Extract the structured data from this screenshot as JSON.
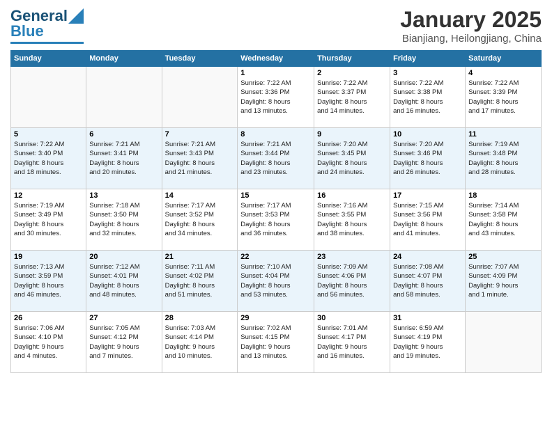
{
  "header": {
    "logo_general": "General",
    "logo_blue": "Blue",
    "month": "January 2025",
    "location": "Bianjiang, Heilongjiang, China"
  },
  "weekdays": [
    "Sunday",
    "Monday",
    "Tuesday",
    "Wednesday",
    "Thursday",
    "Friday",
    "Saturday"
  ],
  "weeks": [
    [
      {
        "day": "",
        "info": ""
      },
      {
        "day": "",
        "info": ""
      },
      {
        "day": "",
        "info": ""
      },
      {
        "day": "1",
        "info": "Sunrise: 7:22 AM\nSunset: 3:36 PM\nDaylight: 8 hours\nand 13 minutes."
      },
      {
        "day": "2",
        "info": "Sunrise: 7:22 AM\nSunset: 3:37 PM\nDaylight: 8 hours\nand 14 minutes."
      },
      {
        "day": "3",
        "info": "Sunrise: 7:22 AM\nSunset: 3:38 PM\nDaylight: 8 hours\nand 16 minutes."
      },
      {
        "day": "4",
        "info": "Sunrise: 7:22 AM\nSunset: 3:39 PM\nDaylight: 8 hours\nand 17 minutes."
      }
    ],
    [
      {
        "day": "5",
        "info": "Sunrise: 7:22 AM\nSunset: 3:40 PM\nDaylight: 8 hours\nand 18 minutes."
      },
      {
        "day": "6",
        "info": "Sunrise: 7:21 AM\nSunset: 3:41 PM\nDaylight: 8 hours\nand 20 minutes."
      },
      {
        "day": "7",
        "info": "Sunrise: 7:21 AM\nSunset: 3:43 PM\nDaylight: 8 hours\nand 21 minutes."
      },
      {
        "day": "8",
        "info": "Sunrise: 7:21 AM\nSunset: 3:44 PM\nDaylight: 8 hours\nand 23 minutes."
      },
      {
        "day": "9",
        "info": "Sunrise: 7:20 AM\nSunset: 3:45 PM\nDaylight: 8 hours\nand 24 minutes."
      },
      {
        "day": "10",
        "info": "Sunrise: 7:20 AM\nSunset: 3:46 PM\nDaylight: 8 hours\nand 26 minutes."
      },
      {
        "day": "11",
        "info": "Sunrise: 7:19 AM\nSunset: 3:48 PM\nDaylight: 8 hours\nand 28 minutes."
      }
    ],
    [
      {
        "day": "12",
        "info": "Sunrise: 7:19 AM\nSunset: 3:49 PM\nDaylight: 8 hours\nand 30 minutes."
      },
      {
        "day": "13",
        "info": "Sunrise: 7:18 AM\nSunset: 3:50 PM\nDaylight: 8 hours\nand 32 minutes."
      },
      {
        "day": "14",
        "info": "Sunrise: 7:17 AM\nSunset: 3:52 PM\nDaylight: 8 hours\nand 34 minutes."
      },
      {
        "day": "15",
        "info": "Sunrise: 7:17 AM\nSunset: 3:53 PM\nDaylight: 8 hours\nand 36 minutes."
      },
      {
        "day": "16",
        "info": "Sunrise: 7:16 AM\nSunset: 3:55 PM\nDaylight: 8 hours\nand 38 minutes."
      },
      {
        "day": "17",
        "info": "Sunrise: 7:15 AM\nSunset: 3:56 PM\nDaylight: 8 hours\nand 41 minutes."
      },
      {
        "day": "18",
        "info": "Sunrise: 7:14 AM\nSunset: 3:58 PM\nDaylight: 8 hours\nand 43 minutes."
      }
    ],
    [
      {
        "day": "19",
        "info": "Sunrise: 7:13 AM\nSunset: 3:59 PM\nDaylight: 8 hours\nand 46 minutes."
      },
      {
        "day": "20",
        "info": "Sunrise: 7:12 AM\nSunset: 4:01 PM\nDaylight: 8 hours\nand 48 minutes."
      },
      {
        "day": "21",
        "info": "Sunrise: 7:11 AM\nSunset: 4:02 PM\nDaylight: 8 hours\nand 51 minutes."
      },
      {
        "day": "22",
        "info": "Sunrise: 7:10 AM\nSunset: 4:04 PM\nDaylight: 8 hours\nand 53 minutes."
      },
      {
        "day": "23",
        "info": "Sunrise: 7:09 AM\nSunset: 4:06 PM\nDaylight: 8 hours\nand 56 minutes."
      },
      {
        "day": "24",
        "info": "Sunrise: 7:08 AM\nSunset: 4:07 PM\nDaylight: 8 hours\nand 58 minutes."
      },
      {
        "day": "25",
        "info": "Sunrise: 7:07 AM\nSunset: 4:09 PM\nDaylight: 9 hours\nand 1 minute."
      }
    ],
    [
      {
        "day": "26",
        "info": "Sunrise: 7:06 AM\nSunset: 4:10 PM\nDaylight: 9 hours\nand 4 minutes."
      },
      {
        "day": "27",
        "info": "Sunrise: 7:05 AM\nSunset: 4:12 PM\nDaylight: 9 hours\nand 7 minutes."
      },
      {
        "day": "28",
        "info": "Sunrise: 7:03 AM\nSunset: 4:14 PM\nDaylight: 9 hours\nand 10 minutes."
      },
      {
        "day": "29",
        "info": "Sunrise: 7:02 AM\nSunset: 4:15 PM\nDaylight: 9 hours\nand 13 minutes."
      },
      {
        "day": "30",
        "info": "Sunrise: 7:01 AM\nSunset: 4:17 PM\nDaylight: 9 hours\nand 16 minutes."
      },
      {
        "day": "31",
        "info": "Sunrise: 6:59 AM\nSunset: 4:19 PM\nDaylight: 9 hours\nand 19 minutes."
      },
      {
        "day": "",
        "info": ""
      }
    ]
  ]
}
